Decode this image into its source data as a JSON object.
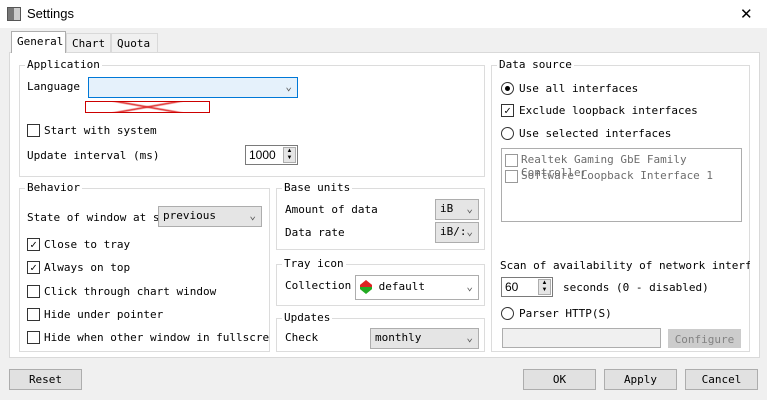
{
  "window": {
    "title": "Settings",
    "close": "✕"
  },
  "tabs": [
    "General",
    "Chart",
    "Quota"
  ],
  "application": {
    "title": "Application",
    "language_label": "Language",
    "language_value": "",
    "start_with_system": "Start with system",
    "update_interval_label": "Update interval (ms)",
    "update_interval_value": "1000"
  },
  "behavior": {
    "title": "Behavior",
    "state_label": "State of window at sta",
    "state_value": "previous",
    "close_to_tray": "Close to tray",
    "always_on_top": "Always on top",
    "click_through": "Click through chart window",
    "hide_under_pointer": "Hide under pointer",
    "hide_fullscreen": "Hide when other window in fullscreen m"
  },
  "base_units": {
    "title": "Base units",
    "amount_label": "Amount of data",
    "amount_value": "iB",
    "rate_label": "Data rate",
    "rate_value": "iB/:"
  },
  "tray_icon": {
    "title": "Tray icon",
    "collection_label": "Collection",
    "collection_value": "default"
  },
  "updates": {
    "title": "Updates",
    "check_label": "Check",
    "check_value": "monthly"
  },
  "data_source": {
    "title": "Data source",
    "use_all": "Use all interfaces",
    "exclude_loopback": "Exclude loopback interfaces",
    "use_selected": "Use selected interfaces",
    "interfaces": [
      "Realtek Gaming GbE Family Controller",
      "Software Loopback Interface 1"
    ],
    "scan_label": "Scan of availability of network interfaces",
    "scan_value": "60",
    "seconds_label": "seconds (0 - disabled)",
    "parser": "Parser HTTP(S)",
    "parser_value": "",
    "configure": "Configure"
  },
  "buttons": {
    "reset": "Reset",
    "ok": "OK",
    "apply": "Apply",
    "cancel": "Cancel"
  }
}
